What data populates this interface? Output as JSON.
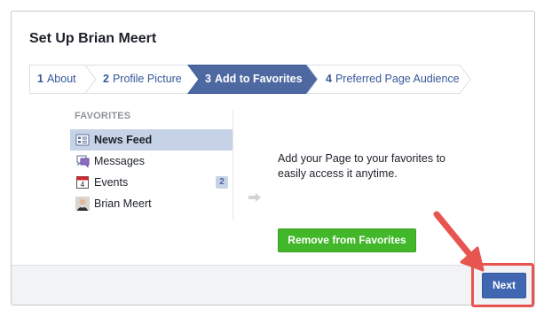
{
  "dialog": {
    "title": "Set Up Brian Meert"
  },
  "steps": [
    {
      "num": "1",
      "label": "About",
      "active": false
    },
    {
      "num": "2",
      "label": "Profile Picture",
      "active": false
    },
    {
      "num": "3",
      "label": "Add to Favorites",
      "active": true
    },
    {
      "num": "4",
      "label": "Preferred Page Audience",
      "active": false
    }
  ],
  "favorites": {
    "heading": "FAVORITES",
    "items": [
      {
        "label": "News Feed",
        "icon": "news-feed-icon",
        "selected": true
      },
      {
        "label": "Messages",
        "icon": "messages-icon",
        "selected": false
      },
      {
        "label": "Events",
        "icon": "events-icon",
        "selected": false,
        "badge": "2"
      },
      {
        "label": "Brian Meert",
        "icon": "profile-avatar-icon",
        "selected": false
      }
    ]
  },
  "main": {
    "description": "Add your Page to your favorites to easily access it anytime.",
    "remove_button": "Remove from Favorites"
  },
  "footer": {
    "next_button": "Next"
  },
  "colors": {
    "accent": "#4267b2",
    "active_step": "#4e69a2",
    "green": "#42b72a",
    "annotation": "#e8544f"
  }
}
